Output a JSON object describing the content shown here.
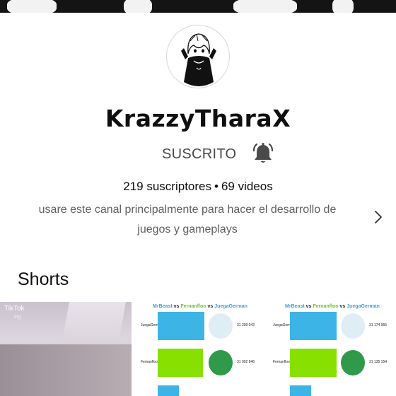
{
  "channel": {
    "name": "KrazzyTharaX",
    "subscribe_state": "SUSCRITO",
    "subscribers": "219 suscriptores",
    "videos": "69 videos",
    "separator": "•",
    "description_line1": "usare este canal principalmente para hacer el desarrollo de",
    "description_line2": "juegos y gameplays"
  },
  "icons": {
    "bell": "notifications-bell-icon",
    "chevron": "chevron-right-icon"
  },
  "shorts": {
    "section_title": "Shorts",
    "items": [
      {
        "tiktok_logo": "TikTok",
        "tiktok_handle": "ing"
      },
      {
        "title_a": "MrBeast",
        "vs1": "vs",
        "title_b": "Fernanfloo",
        "vs2": "vs",
        "title_c": "JuegaGerman",
        "rows": [
          {
            "label": "JuegaGerman",
            "value": "31 209 042"
          },
          {
            "label": "Fernanfloo",
            "value": "31 002 846"
          }
        ]
      },
      {
        "title_a": "MrBeast",
        "vs1": "vs",
        "title_b": "Fernanfloo",
        "vs2": "vs",
        "title_c": "JuegaGerman",
        "rows": [
          {
            "label": "JuegaGerman",
            "value": "31 174 955"
          },
          {
            "label": "Fernanfloo",
            "value": "31 135 154"
          }
        ]
      }
    ]
  },
  "colors": {
    "text_primary": "#0f0f0f",
    "text_secondary": "#5f5f5f",
    "bar_blue": "#3cb4e6",
    "bar_green": "#88e000"
  }
}
